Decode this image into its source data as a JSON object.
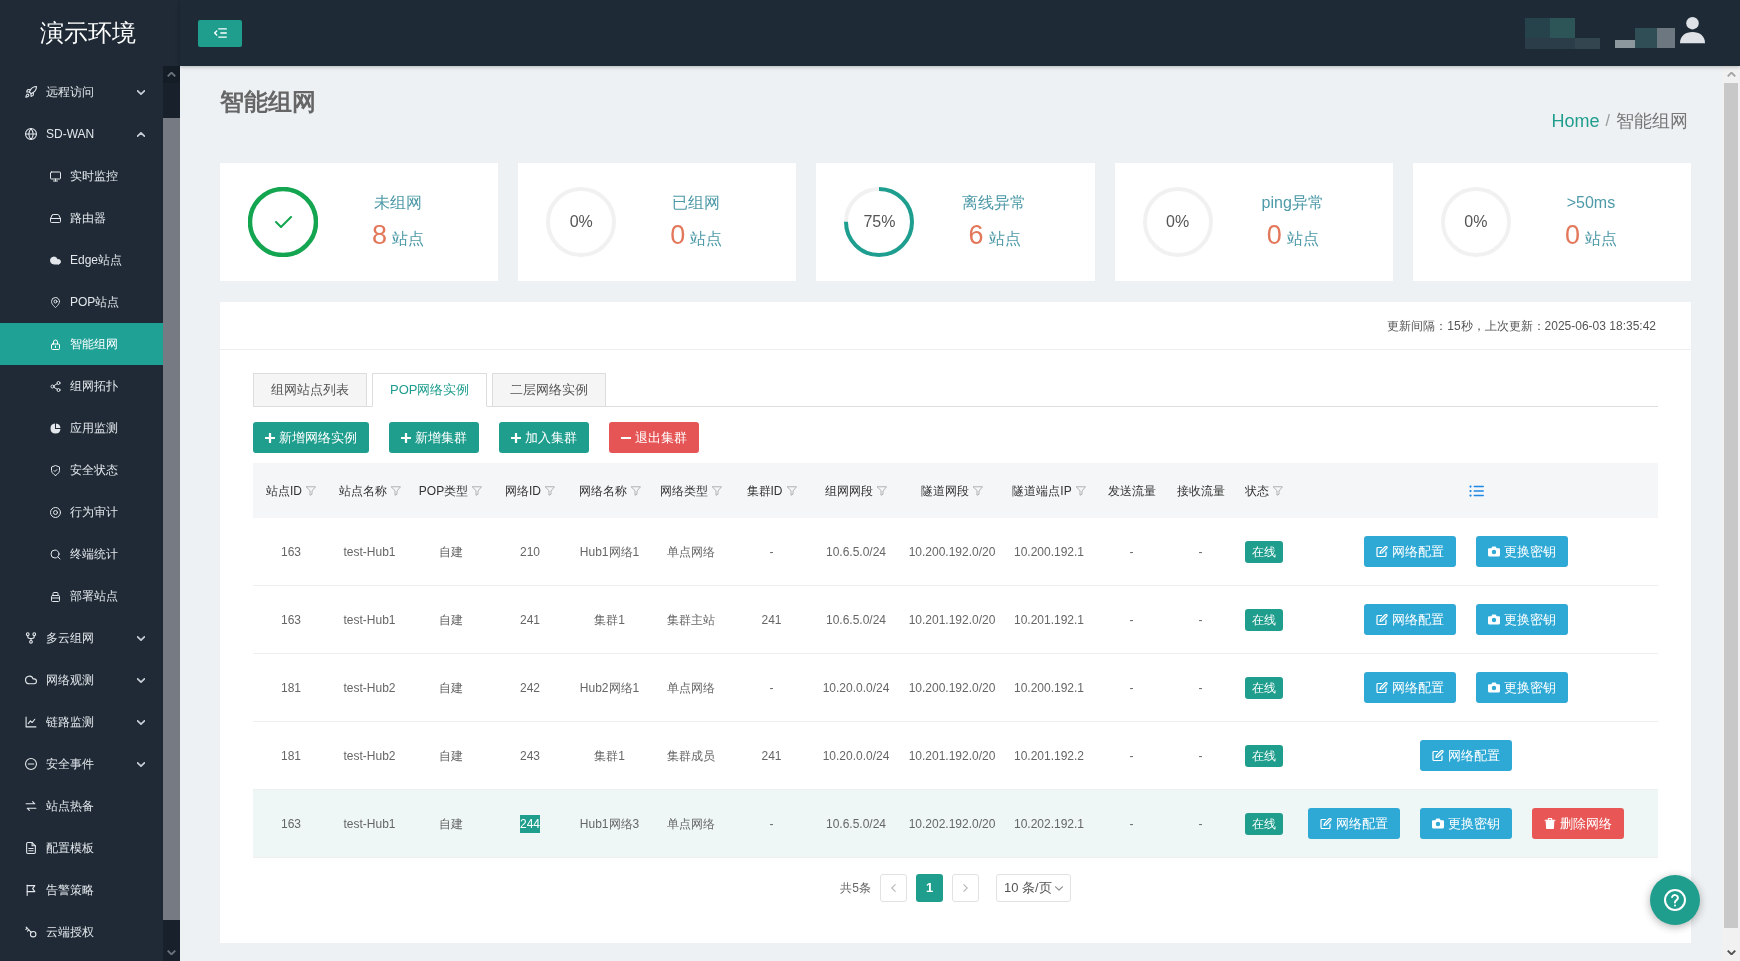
{
  "sidebar": {
    "logo": "演示环境",
    "items": [
      {
        "label": "远程访问",
        "expanded": false,
        "selected": false
      },
      {
        "label": "SD-WAN",
        "expanded": true,
        "selected": false,
        "children": [
          {
            "label": "实时监控",
            "selected": false
          },
          {
            "label": "路由器",
            "selected": false
          },
          {
            "label": "Edge站点",
            "selected": false
          },
          {
            "label": "POP站点",
            "selected": false
          },
          {
            "label": "智能组网",
            "selected": true
          },
          {
            "label": "组网拓扑",
            "selected": false
          },
          {
            "label": "应用监测",
            "selected": false
          },
          {
            "label": "安全状态",
            "selected": false
          },
          {
            "label": "行为审计",
            "selected": false
          },
          {
            "label": "终端统计",
            "selected": false
          },
          {
            "label": "部署站点",
            "selected": false
          }
        ]
      },
      {
        "label": "多云组网",
        "expanded": false,
        "selected": false
      },
      {
        "label": "网络观测",
        "expanded": false,
        "selected": false
      },
      {
        "label": "链路监测",
        "expanded": false,
        "selected": false
      },
      {
        "label": "安全事件",
        "expanded": false,
        "selected": false
      },
      {
        "label": "站点热备",
        "selected": false
      },
      {
        "label": "配置模板",
        "selected": false
      },
      {
        "label": "告警策略",
        "selected": false
      },
      {
        "label": "云端授权",
        "selected": false
      }
    ]
  },
  "page": {
    "title": "智能组网",
    "breadcrumb": {
      "separator": "/",
      "items": [
        {
          "label": "Home",
          "kind": "link"
        },
        {
          "label": "智能组网",
          "kind": "current"
        }
      ]
    }
  },
  "stats": [
    {
      "kind": "done",
      "label": "未组网",
      "count": "8",
      "unit": "站点"
    },
    {
      "kind": "percent",
      "percent": "0%",
      "label": "已组网",
      "count": "0",
      "unit": "站点"
    },
    {
      "kind": "percent",
      "percent": "75%",
      "label": "离线异常",
      "count": "6",
      "unit": "站点"
    },
    {
      "kind": "percent",
      "percent": "0%",
      "label": "ping异常",
      "count": "0",
      "unit": "站点"
    },
    {
      "kind": "percent",
      "percent": "0%",
      "label": ">50ms",
      "count": "0",
      "unit": "站点"
    }
  ],
  "panel": {
    "update_info": "更新间隔：15秒，上次更新：2025-06-03 18:35:42",
    "tabs": [
      {
        "label": "组网站点列表",
        "selected": false
      },
      {
        "label": "POP网络实例",
        "selected": true
      },
      {
        "label": "二层网络实例",
        "selected": false
      }
    ],
    "toolbar": [
      {
        "label": "新增网络实例",
        "kind": "add"
      },
      {
        "label": "新增集群",
        "kind": "add"
      },
      {
        "label": "加入集群",
        "kind": "add"
      },
      {
        "label": "退出集群",
        "kind": "remove"
      }
    ],
    "table": {
      "columns": [
        {
          "label": "站点ID",
          "filterable": true
        },
        {
          "label": "站点名称",
          "filterable": true
        },
        {
          "label": "POP类型",
          "filterable": true
        },
        {
          "label": "网络ID",
          "filterable": true
        },
        {
          "label": "网络名称",
          "filterable": true
        },
        {
          "label": "网络类型",
          "filterable": true
        },
        {
          "label": "集群ID",
          "filterable": true
        },
        {
          "label": "组网网段",
          "filterable": true
        },
        {
          "label": "隧道网段",
          "filterable": true
        },
        {
          "label": "隧道端点IP",
          "filterable": true
        },
        {
          "label": "发送流量",
          "filterable": false
        },
        {
          "label": "接收流量",
          "filterable": false
        },
        {
          "label": "状态",
          "filterable": true
        }
      ],
      "rows": [
        {
          "cells": [
            "163",
            "test-Hub1",
            "自建",
            "210",
            "Hub1网络1",
            "单点网络",
            "-",
            "10.6.5.0/24",
            "10.200.192.0/20",
            "10.200.192.1",
            "-",
            "-"
          ],
          "status": {
            "label": "在线",
            "kind": "online"
          },
          "actions": [
            {
              "label": "网络配置",
              "kind": "edit"
            },
            {
              "label": "更换密钥",
              "kind": "key"
            }
          ],
          "hovered": false,
          "network_id_text_selected": false
        },
        {
          "cells": [
            "163",
            "test-Hub1",
            "自建",
            "241",
            "集群1",
            "集群主站",
            "241",
            "10.6.5.0/24",
            "10.201.192.0/20",
            "10.201.192.1",
            "-",
            "-"
          ],
          "status": {
            "label": "在线",
            "kind": "online"
          },
          "actions": [
            {
              "label": "网络配置",
              "kind": "edit"
            },
            {
              "label": "更换密钥",
              "kind": "key"
            }
          ],
          "hovered": false,
          "network_id_text_selected": false
        },
        {
          "cells": [
            "181",
            "test-Hub2",
            "自建",
            "242",
            "Hub2网络1",
            "单点网络",
            "-",
            "10.20.0.0/24",
            "10.200.192.0/20",
            "10.200.192.1",
            "-",
            "-"
          ],
          "status": {
            "label": "在线",
            "kind": "online"
          },
          "actions": [
            {
              "label": "网络配置",
              "kind": "edit"
            },
            {
              "label": "更换密钥",
              "kind": "key"
            }
          ],
          "hovered": false,
          "network_id_text_selected": false
        },
        {
          "cells": [
            "181",
            "test-Hub2",
            "自建",
            "243",
            "集群1",
            "集群成员",
            "241",
            "10.20.0.0/24",
            "10.201.192.0/20",
            "10.201.192.2",
            "-",
            "-"
          ],
          "status": {
            "label": "在线",
            "kind": "online"
          },
          "actions": [
            {
              "label": "网络配置",
              "kind": "edit"
            }
          ],
          "hovered": false,
          "network_id_text_selected": false
        },
        {
          "cells": [
            "163",
            "test-Hub1",
            "自建",
            "244",
            "Hub1网络3",
            "单点网络",
            "-",
            "10.6.5.0/24",
            "10.202.192.0/20",
            "10.202.192.1",
            "-",
            "-"
          ],
          "status": {
            "label": "在线",
            "kind": "online"
          },
          "actions": [
            {
              "label": "网络配置",
              "kind": "edit"
            },
            {
              "label": "更换密钥",
              "kind": "key"
            },
            {
              "label": "删除网络",
              "kind": "delete"
            }
          ],
          "hovered": true,
          "network_id_text_selected": true
        }
      ]
    },
    "pagination": {
      "total": "共5条",
      "pages": [
        {
          "label": "1",
          "selected": true
        }
      ],
      "page_size": "10 条/页"
    }
  }
}
